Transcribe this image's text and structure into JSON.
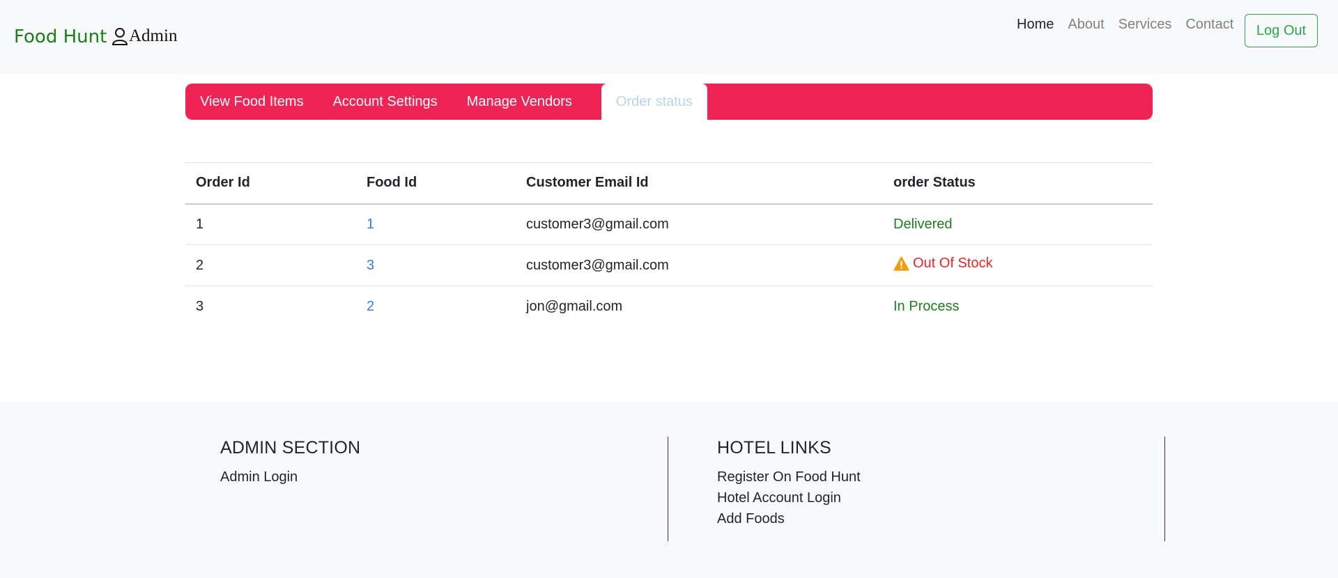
{
  "navbar": {
    "brand": "Food Hunt",
    "role_label": "Admin",
    "links": [
      "Home",
      "About",
      "Services",
      "Contact"
    ],
    "logout_label": "Log Out"
  },
  "tabs": [
    "View Food Items",
    "Account Settings",
    "Manage Vendors",
    "Order status"
  ],
  "table": {
    "headers": [
      "Order Id",
      "Food Id",
      "Customer Email Id",
      "order Status"
    ],
    "rows": [
      {
        "order_id": "1",
        "food_id": "1",
        "email": "customer3@gmail.com",
        "status": "Delivered"
      },
      {
        "order_id": "2",
        "food_id": "3",
        "email": "customer3@gmail.com",
        "status": "Out Of Stock"
      },
      {
        "order_id": "3",
        "food_id": "2",
        "email": "jon@gmail.com",
        "status": "In Process"
      }
    ]
  },
  "footer": {
    "admin_heading": "ADMIN SECTION",
    "admin_links": [
      "Admin Login"
    ],
    "hotel_heading": "HOTEL LINKS",
    "hotel_links": [
      "Register On Food Hunt",
      "Hotel Account Login",
      "Add Foods"
    ]
  },
  "colors": {
    "brand": "#198019",
    "tab_bar": "#ef2455",
    "status_ok": "#1c801c",
    "status_error": "#f02222",
    "link": "#2f7bf5"
  }
}
